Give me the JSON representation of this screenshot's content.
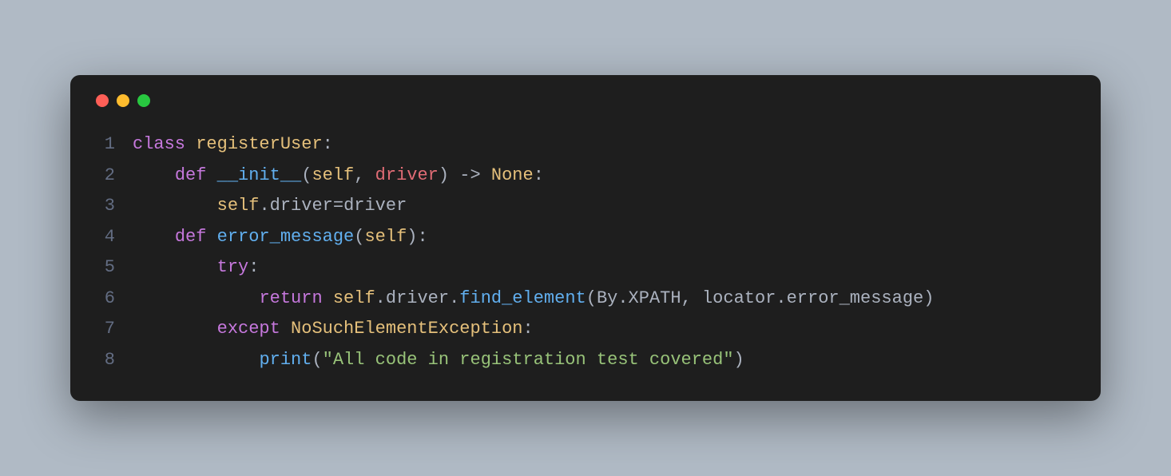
{
  "traffic_lights": {
    "red": "#ff5f57",
    "yellow": "#febc2e",
    "green": "#28c840"
  },
  "code": {
    "lines": [
      {
        "n": "1"
      },
      {
        "n": "2"
      },
      {
        "n": "3"
      },
      {
        "n": "4"
      },
      {
        "n": "5"
      },
      {
        "n": "6"
      },
      {
        "n": "7"
      },
      {
        "n": "8"
      }
    ],
    "l1": {
      "kw": "class",
      "sp": " ",
      "name": "registerUser",
      "colon": ":"
    },
    "l2": {
      "indent": "    ",
      "kw": "def",
      "sp": " ",
      "fn": "__init__",
      "open": "(",
      "self": "self",
      "comma": ", ",
      "param": "driver",
      "close": ")",
      "arrow": " -> ",
      "ret": "None",
      "colon": ":"
    },
    "l3": {
      "indent": "        ",
      "self": "self",
      "dot": ".",
      "attr": "driver",
      "eq": "=",
      "val": "driver"
    },
    "l4": {
      "indent": "    ",
      "kw": "def",
      "sp": " ",
      "fn": "error_message",
      "open": "(",
      "self": "self",
      "close": ")",
      "colon": ":"
    },
    "l5": {
      "indent": "        ",
      "kw": "try",
      "colon": ":"
    },
    "l6": {
      "indent": "            ",
      "kw": "return",
      "sp": " ",
      "self": "self",
      "dot1": ".",
      "driver": "driver",
      "dot2": ".",
      "fn": "find_element",
      "open": "(",
      "by": "By",
      "dot3": ".",
      "xpath": "XPATH",
      "comma": ", ",
      "loc": "locator",
      "dot4": ".",
      "em": "error_message",
      "close": ")"
    },
    "l7": {
      "indent": "        ",
      "kw": "except",
      "sp": " ",
      "exc": "NoSuchElementException",
      "colon": ":"
    },
    "l8": {
      "indent": "            ",
      "fn": "print",
      "open": "(",
      "str": "\"All code in registration test covered\"",
      "close": ")"
    }
  }
}
